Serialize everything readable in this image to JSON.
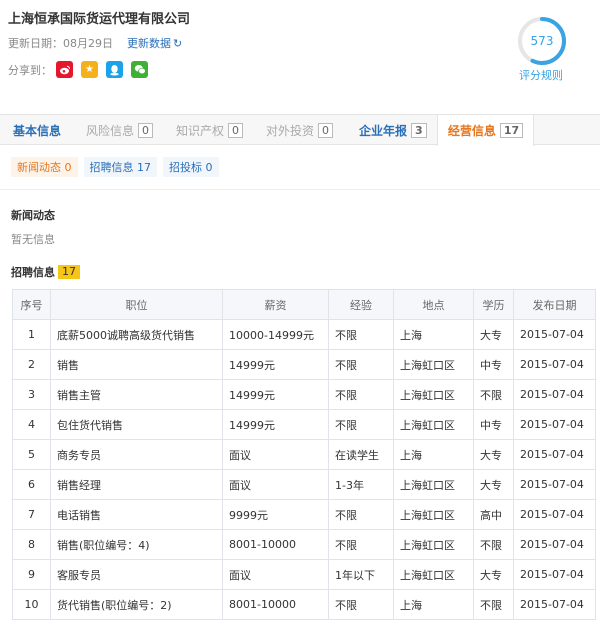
{
  "company": {
    "name": "上海恒承国际货运代理有限公司",
    "update_label": "更新日期：08月29日",
    "update_link": "更新数据",
    "share_label": "分享到："
  },
  "score": {
    "value": "573",
    "fraction": 0.57,
    "rule_label": "评分规则",
    "color": "#3aa3e3"
  },
  "tabs": [
    {
      "label": "基本信息",
      "count": ""
    },
    {
      "label": "风险信息",
      "count": "0"
    },
    {
      "label": "知识产权",
      "count": "0"
    },
    {
      "label": "对外投资",
      "count": "0"
    },
    {
      "label": "企业年报",
      "count": "3"
    },
    {
      "label": "经营信息",
      "count": "17"
    }
  ],
  "subtabs": [
    {
      "label": "新闻动态 0"
    },
    {
      "label": "招聘信息 17"
    },
    {
      "label": "招投标 0"
    }
  ],
  "news": {
    "title": "新闻动态",
    "empty": "暂无信息"
  },
  "jobs": {
    "title": "招聘信息",
    "count": "17",
    "headers": [
      "序号",
      "职位",
      "薪资",
      "经验",
      "地点",
      "学历",
      "发布日期"
    ],
    "rows": [
      [
        "1",
        "底薪5000诚聘高级货代销售",
        "10000-14999元",
        "不限",
        "上海",
        "大专",
        "2015-07-04"
      ],
      [
        "2",
        "销售",
        "14999元",
        "不限",
        "上海虹口区",
        "中专",
        "2015-07-04"
      ],
      [
        "3",
        "销售主管",
        "14999元",
        "不限",
        "上海虹口区",
        "不限",
        "2015-07-04"
      ],
      [
        "4",
        "包住货代销售",
        "14999元",
        "不限",
        "上海虹口区",
        "中专",
        "2015-07-04"
      ],
      [
        "5",
        "商务专员",
        "面议",
        "在读学生",
        "上海",
        "大专",
        "2015-07-04"
      ],
      [
        "6",
        "销售经理",
        "面议",
        "1-3年",
        "上海虹口区",
        "大专",
        "2015-07-04"
      ],
      [
        "7",
        "电话销售",
        "9999元",
        "不限",
        "上海虹口区",
        "高中",
        "2015-07-04"
      ],
      [
        "8",
        "销售(职位编号：4)",
        "8001-10000",
        "不限",
        "上海虹口区",
        "不限",
        "2015-07-04"
      ],
      [
        "9",
        "客服专员",
        "面议",
        "1年以下",
        "上海虹口区",
        "大专",
        "2015-07-04"
      ],
      [
        "10",
        "货代销售(职位编号：2)",
        "8001-10000",
        "不限",
        "上海",
        "不限",
        "2015-07-04"
      ]
    ]
  }
}
